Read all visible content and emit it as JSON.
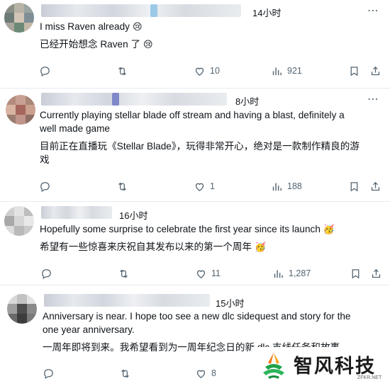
{
  "tweets": [
    {
      "time": "14小时",
      "text_en": "I miss Raven already",
      "text_zh": "已经开始想念 Raven 了",
      "emoji_en": "😢",
      "emoji_zh": "😢",
      "reply_count": "",
      "retweet_count": "",
      "like_count": "10",
      "view_count": "921"
    },
    {
      "time": "8小时",
      "text_en_1": "Currently playing stellar blade off stream and having a blast, definitely a",
      "text_en_2": "well made game",
      "text_zh_1": "目前正在直播玩《Stellar Blade》，玩得非常开心，绝对是一款制作精良的游",
      "text_zh_2": "戏",
      "reply_count": "",
      "retweet_count": "",
      "like_count": "1",
      "view_count": "188"
    },
    {
      "time": "16小时",
      "text_en": "Hopefully some surprise to celebrate the first year since its launch",
      "text_zh": "希望有一些惊喜来庆祝自其发布以来的第一个周年",
      "emoji_en": "🥳",
      "emoji_zh": "🥳",
      "reply_count": "",
      "retweet_count": "",
      "like_count": "11",
      "view_count": "1,287"
    },
    {
      "time": "15小时",
      "text_en_1": "Anniversary is near. I hope too see a new dlc sidequest and story for the",
      "text_en_2": "one year anniversary.",
      "text_zh": "一周年即将到来。我希望看到为一周年纪念日的新 dlc 支线任务和故事。",
      "reply_count": "",
      "retweet_count": "",
      "like_count": "8"
    }
  ],
  "watermark": {
    "title": "智风科技",
    "url": "ZFKR.NET"
  }
}
